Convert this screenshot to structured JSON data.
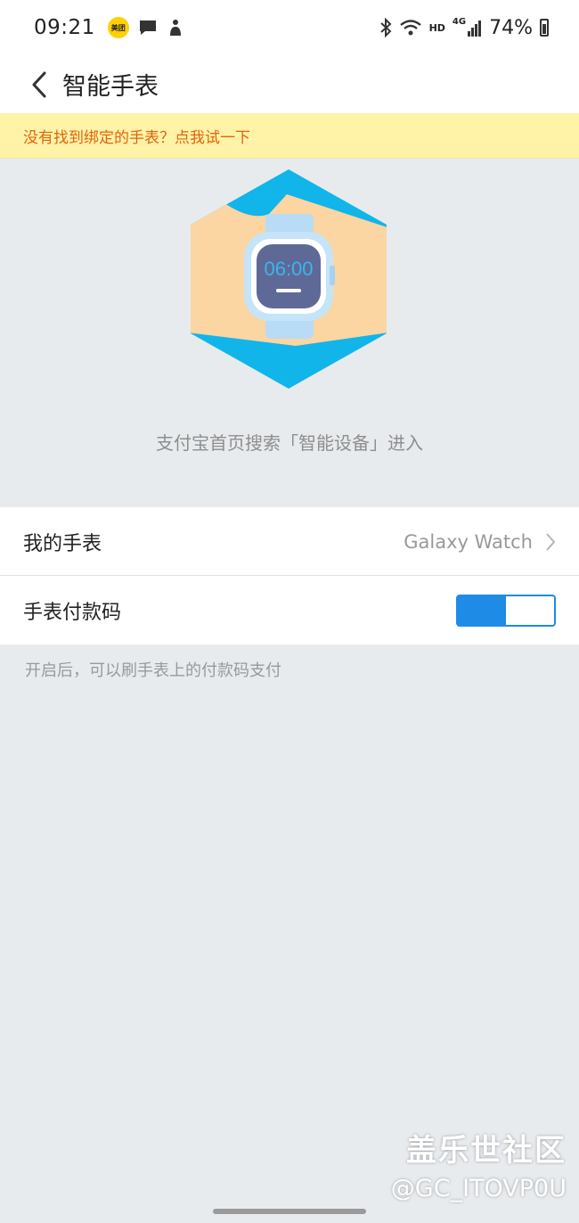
{
  "status_bar": {
    "time": "09:21",
    "app_badge": "美团",
    "network_label": "HD",
    "signal_label": "4G",
    "battery_text": "74%"
  },
  "nav": {
    "title": "智能手表"
  },
  "notice": {
    "text": "没有找到绑定的手表？点我试一下"
  },
  "hero": {
    "watch_time": "06:00",
    "hint": "支付宝首页搜索「智能设备」进入"
  },
  "settings": {
    "my_watch_label": "我的手表",
    "my_watch_value": "Galaxy Watch",
    "pay_code_label": "手表付款码",
    "pay_code_enabled": true
  },
  "footnote": "开启后，可以刷手表上的付款码支付",
  "watermark": {
    "title": "盖乐世社区",
    "user": "@GC_ITOVP0U"
  },
  "colors": {
    "accent": "#1e8be6",
    "notice_bg": "#fff3a8",
    "notice_text": "#e2640a",
    "page_bg": "#e8ebee"
  }
}
